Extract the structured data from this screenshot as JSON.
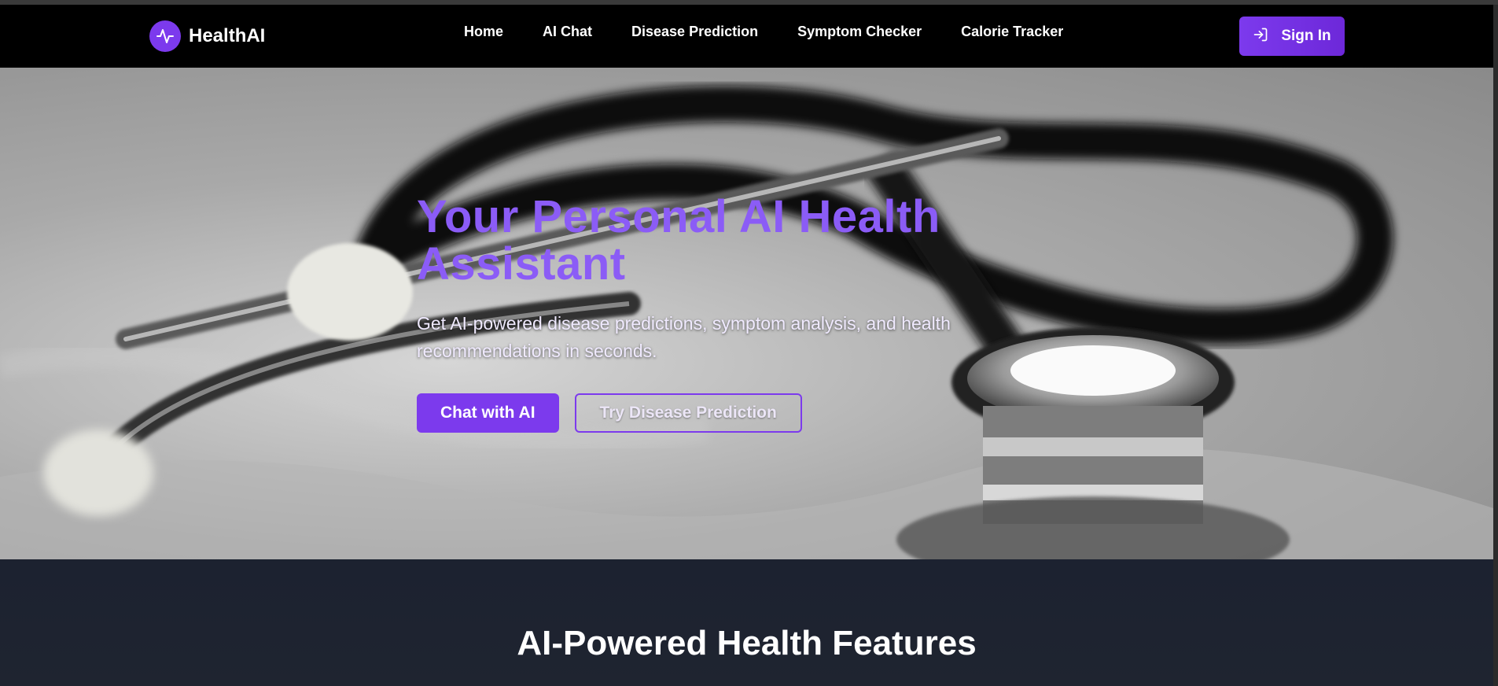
{
  "brand": {
    "name": "HealthAI",
    "logo_icon": "pulse-icon",
    "accent": "#7c3aed"
  },
  "nav": {
    "links": [
      "Home",
      "AI Chat",
      "Disease Prediction",
      "Symptom Checker",
      "Calorie Tracker"
    ]
  },
  "signin": {
    "label": "Sign In",
    "icon": "login-arrow-icon"
  },
  "hero": {
    "title": "Your Personal AI Health Assistant",
    "subtitle": "Get AI-powered disease predictions, symptom analysis, and health recommendations in seconds.",
    "primary_button": "Chat with AI",
    "secondary_button": "Try Disease Prediction",
    "background": "stethoscope-photo"
  },
  "features": {
    "title": "AI-Powered Health Features"
  }
}
